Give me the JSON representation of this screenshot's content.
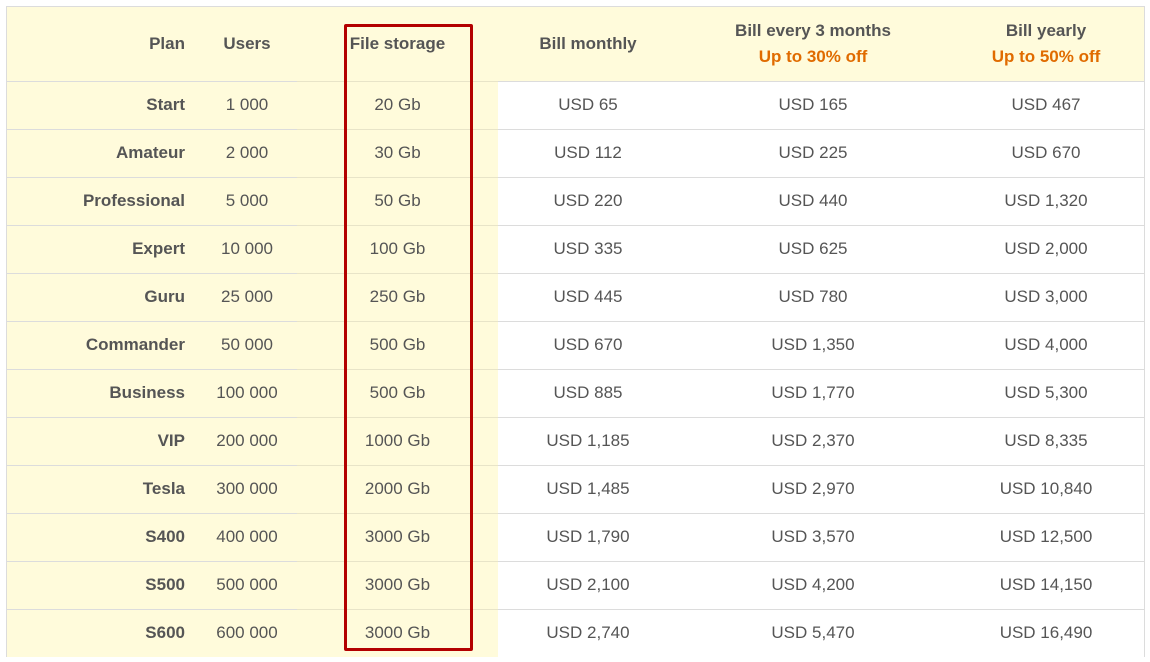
{
  "headers": {
    "plan": "Plan",
    "users": "Users",
    "storage": "File storage",
    "monthly": "Bill monthly",
    "quarterly": "Bill every 3 months",
    "quarterly_discount": "Up to 30% off",
    "yearly": "Bill yearly",
    "yearly_discount": "Up to 50% off"
  },
  "rows": [
    {
      "plan": "Start",
      "users": "1 000",
      "storage": "20 Gb",
      "monthly": "USD 65",
      "quarterly": "USD 165",
      "yearly": "USD 467"
    },
    {
      "plan": "Amateur",
      "users": "2 000",
      "storage": "30 Gb",
      "monthly": "USD 112",
      "quarterly": "USD 225",
      "yearly": "USD 670"
    },
    {
      "plan": "Professional",
      "users": "5 000",
      "storage": "50 Gb",
      "monthly": "USD 220",
      "quarterly": "USD 440",
      "yearly": "USD 1,320"
    },
    {
      "plan": "Expert",
      "users": "10 000",
      "storage": "100 Gb",
      "monthly": "USD 335",
      "quarterly": "USD 625",
      "yearly": "USD 2,000"
    },
    {
      "plan": "Guru",
      "users": "25 000",
      "storage": "250 Gb",
      "monthly": "USD 445",
      "quarterly": "USD 780",
      "yearly": "USD 3,000"
    },
    {
      "plan": "Commander",
      "users": "50 000",
      "storage": "500 Gb",
      "monthly": "USD 670",
      "quarterly": "USD 1,350",
      "yearly": "USD 4,000"
    },
    {
      "plan": "Business",
      "users": "100 000",
      "storage": "500 Gb",
      "monthly": "USD 885",
      "quarterly": "USD 1,770",
      "yearly": "USD 5,300"
    },
    {
      "plan": "VIP",
      "users": "200 000",
      "storage": "1000 Gb",
      "monthly": "USD 1,185",
      "quarterly": "USD 2,370",
      "yearly": "USD 8,335"
    },
    {
      "plan": "Tesla",
      "users": "300 000",
      "storage": "2000 Gb",
      "monthly": "USD 1,485",
      "quarterly": "USD 2,970",
      "yearly": "USD 10,840"
    },
    {
      "plan": "S400",
      "users": "400 000",
      "storage": "3000 Gb",
      "monthly": "USD 1,790",
      "quarterly": "USD 3,570",
      "yearly": "USD 12,500"
    },
    {
      "plan": "S500",
      "users": "500 000",
      "storage": "3000 Gb",
      "monthly": "USD 2,100",
      "quarterly": "USD 4,200",
      "yearly": "USD 14,150"
    },
    {
      "plan": "S600",
      "users": "600 000",
      "storage": "3000 Gb",
      "monthly": "USD 2,740",
      "quarterly": "USD 5,470",
      "yearly": "USD 16,490"
    }
  ],
  "colors": {
    "tinted_background": "#fffbdb",
    "discount_text": "#e06b00",
    "highlight_border": "#b30000",
    "grid_line": "#dcdcdc"
  }
}
